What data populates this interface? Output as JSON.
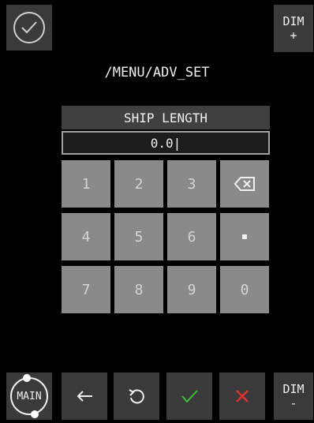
{
  "header": {
    "path": "/MENU/ADV_SET",
    "dim_plus": [
      "DIM",
      "+"
    ],
    "dim_minus": [
      "DIM",
      "-"
    ]
  },
  "input": {
    "title": "SHIP LENGTH",
    "value": "0.0|"
  },
  "keypad": {
    "rows": [
      [
        "1",
        "2",
        "3",
        "⌫"
      ],
      [
        "4",
        "5",
        "6",
        "."
      ],
      [
        "7",
        "8",
        "9",
        "0"
      ]
    ]
  },
  "footer": {
    "main": "MAIN"
  },
  "colors": {
    "ok": "#3fbf3f",
    "cancel": "#e03030",
    "key": "#8a8a8a",
    "panel": "#3a3a3a"
  },
  "icons": [
    "check-icon",
    "backspace-icon",
    "arrow-left-icon",
    "undo-icon",
    "confirm-icon",
    "cancel-icon"
  ]
}
